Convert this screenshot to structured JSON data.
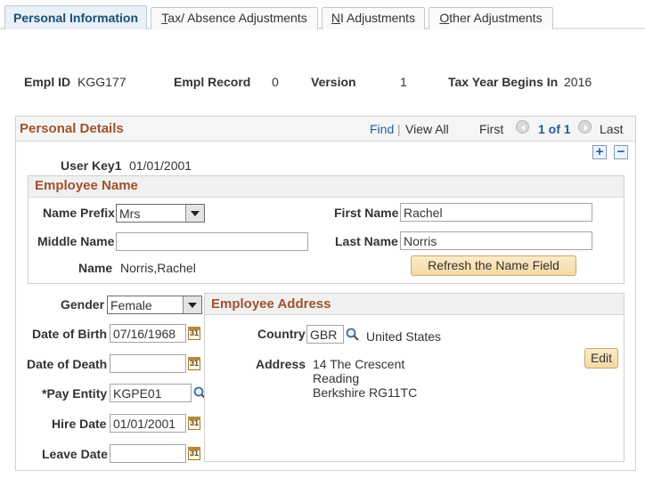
{
  "tabs": [
    {
      "label": "Personal Information"
    },
    {
      "label_u": "T",
      "label_rest": "ax/ Absence Adjustments"
    },
    {
      "label_u": "N",
      "label_rest": "I Adjustments"
    },
    {
      "label_u": "O",
      "label_rest": "ther Adjustments"
    }
  ],
  "header": {
    "empl_id_label": "Empl ID",
    "empl_id": "KGG177",
    "empl_record_label": "Empl Record",
    "empl_record": "0",
    "version_label": "Version",
    "version": "1",
    "tax_year_label": "Tax Year Begins In",
    "tax_year": "2016"
  },
  "personal_details": {
    "title": "Personal Details",
    "find": "Find",
    "sep": "|",
    "view_all": "View All",
    "first": "First",
    "count": "1 of 1",
    "last": "Last",
    "user_key_label": "User Key1",
    "user_key": "01/01/2001"
  },
  "employee_name": {
    "title": "Employee Name",
    "prefix_label": "Name Prefix",
    "prefix": "Mrs",
    "first_name_label": "First Name",
    "first_name": "Rachel",
    "middle_name_label": "Middle Name",
    "middle_name": "",
    "last_name_label": "Last Name",
    "last_name": "Norris",
    "name_label": "Name",
    "name": "Norris,Rachel",
    "refresh_button": "Refresh the Name Field"
  },
  "personal": {
    "gender_label": "Gender",
    "gender": "Female",
    "dob_label": "Date of Birth",
    "dob": "07/16/1968",
    "dod_label": "Date of Death",
    "dod": "",
    "pay_entity_label": "*Pay Entity",
    "pay_entity": "KGPE01",
    "hire_date_label": "Hire Date",
    "hire_date": "01/01/2001",
    "leave_date_label": "Leave Date",
    "leave_date": ""
  },
  "address": {
    "title": "Employee Address",
    "country_label": "Country",
    "country_code": "GBR",
    "country_name": "United States",
    "address_label": "Address",
    "line1": "14 The Crescent",
    "line2": "Reading",
    "line3": "Berkshire RG11TC",
    "edit_button": "Edit"
  },
  "icons": {
    "calendar": "calendar-icon",
    "lookup": "magnifier-icon",
    "prev": "previous-arrow-icon",
    "next": "next-arrow-icon",
    "add": "add-row-icon",
    "delete": "delete-row-icon",
    "dropdown": "chevron-down-icon"
  }
}
